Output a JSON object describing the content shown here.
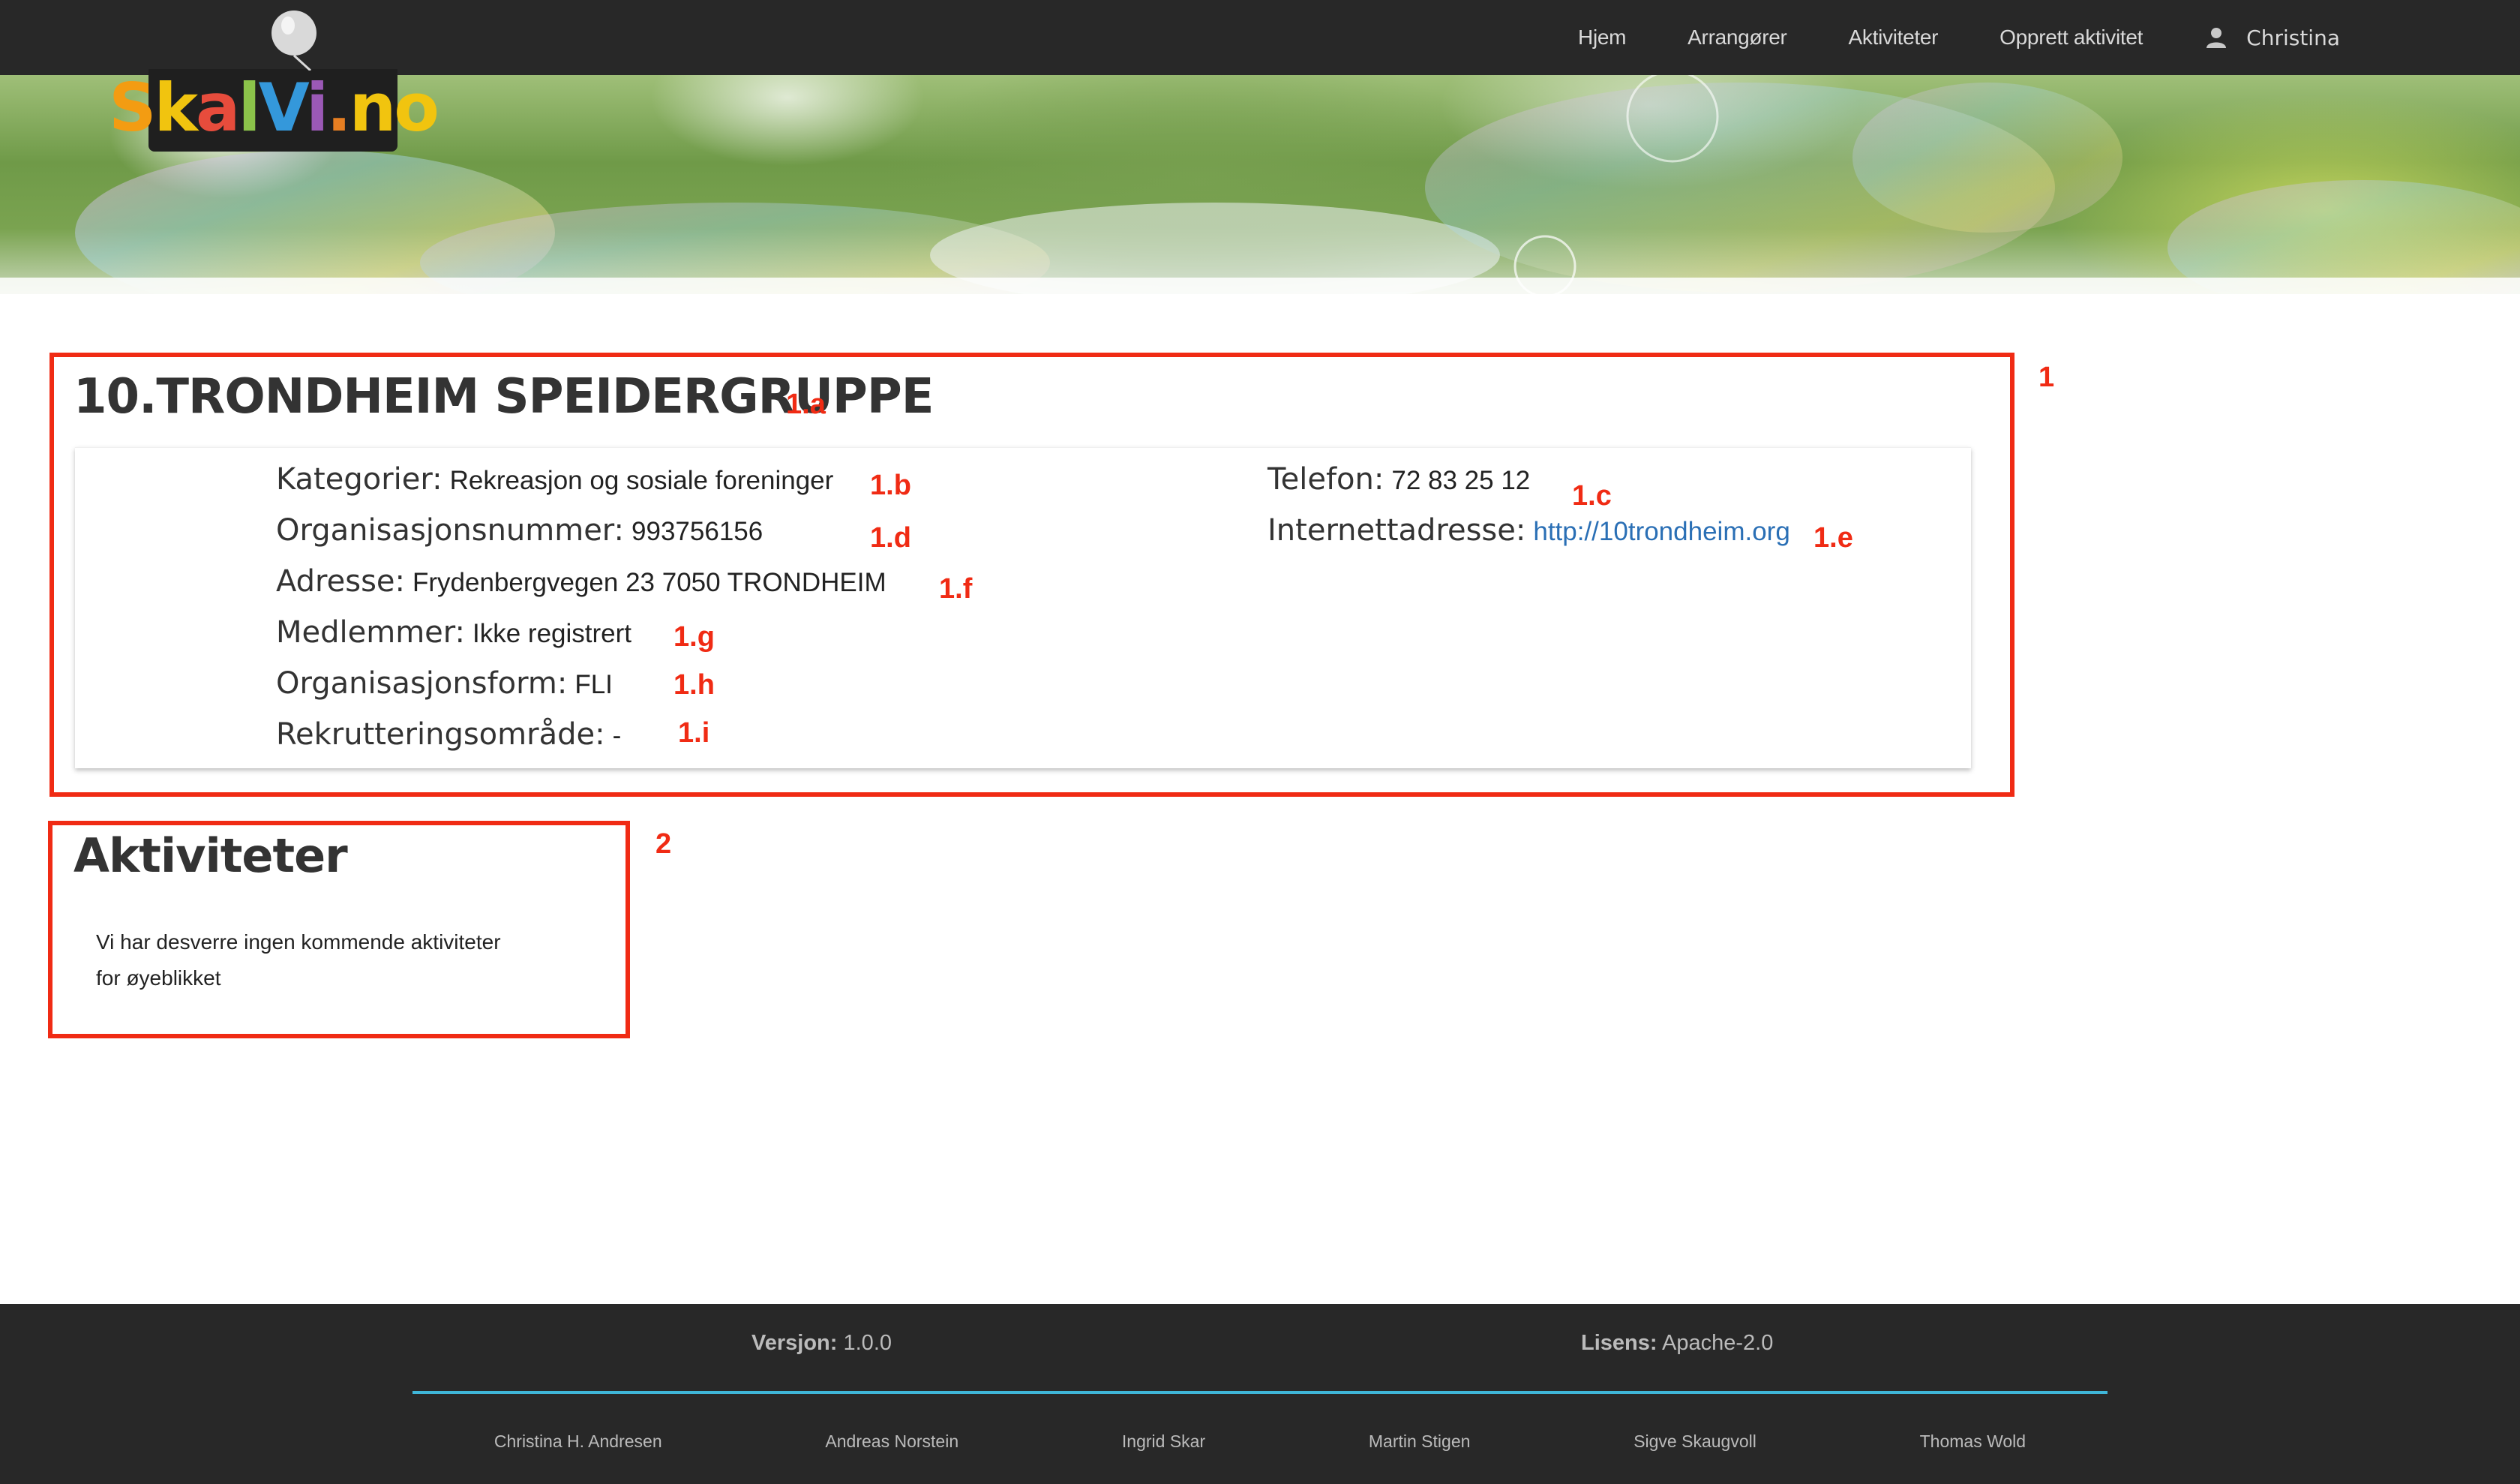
{
  "navbar": {
    "links": [
      "Hjem",
      "Arrangører",
      "Aktiviteter",
      "Opprett aktivitet"
    ],
    "user": "Christina",
    "user_icon": "user-icon"
  },
  "logo": {
    "text": "SkalVi.no",
    "letters": [
      "S",
      "k",
      "a",
      "l",
      "V",
      "i",
      ".",
      "no"
    ]
  },
  "organization": {
    "name": "10.TRONDHEIM SPEIDERGRUPPE",
    "fields": {
      "kategorier": {
        "label": "Kategorier:",
        "value": "Rekreasjon og sosiale foreninger"
      },
      "organisasjonsnummer": {
        "label": "Organisasjonsnummer:",
        "value": "993756156"
      },
      "adresse": {
        "label": "Adresse:",
        "value": "Frydenbergvegen 23 7050 TRONDHEIM"
      },
      "medlemmer": {
        "label": "Medlemmer:",
        "value": "Ikke registrert"
      },
      "organisasjonsform": {
        "label": "Organisasjonsform:",
        "value": "FLI"
      },
      "rekrutteringsomrade": {
        "label": "Rekrutteringsområde:",
        "value": "-"
      },
      "telefon": {
        "label": "Telefon:",
        "value": "72 83 25 12"
      },
      "internettadresse": {
        "label": "Internettadresse:",
        "value": "http://10trondheim.org"
      }
    }
  },
  "activities": {
    "title": "Aktiviteter",
    "empty_line1": "Vi har desverre ingen kommende aktiviteter",
    "empty_line2": "for øyeblikket"
  },
  "annotations": {
    "box1": "1",
    "box2": "2",
    "a": "1.a",
    "b": "1.b",
    "c": "1.c",
    "d": "1.d",
    "e": "1.e",
    "f": "1.f",
    "g": "1.g",
    "h": "1.h",
    "i": "1.i",
    "color": "#f02b14"
  },
  "footer": {
    "version_label": "Versjon:",
    "version": "1.0.0",
    "license_label": "Lisens:",
    "license": "Apache-2.0",
    "authors": [
      "Christina H. Andresen",
      "Andreas Norstein",
      "Ingrid Skar",
      "Martin Stigen",
      "Sigve Skaugvoll",
      "Thomas Wold"
    ],
    "accent": "#3fb6d8"
  }
}
